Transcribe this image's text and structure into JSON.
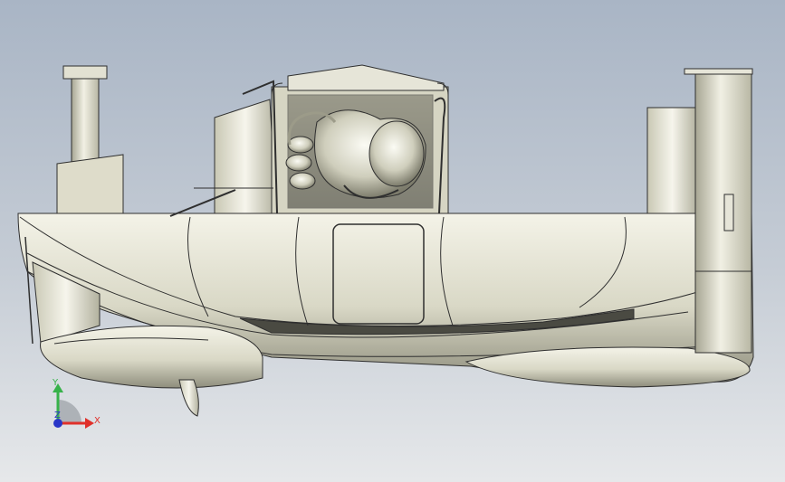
{
  "viewport": {
    "background_top": "#a9b5c5",
    "background_bottom": "#e6e8ea",
    "model": "hovercraft-with-engine-side-view",
    "part_color": "#e7e6d7",
    "edge_color": "#2f2f2f"
  },
  "triad": {
    "x_label": "X",
    "y_label": "Y",
    "z_label": "Z",
    "x_color": "#e0302a",
    "y_color": "#37b24a",
    "z_color": "#2936c8"
  }
}
